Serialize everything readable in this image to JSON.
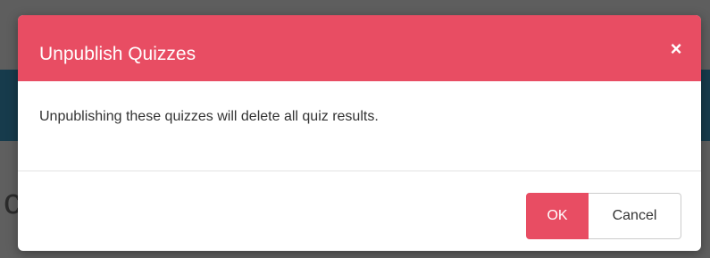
{
  "background": {
    "partial_glyph": "c"
  },
  "dialog": {
    "title": "Unpublish Quizzes",
    "close_glyph": "×",
    "message": "Unpublishing these quizzes will delete all quiz results.",
    "ok_label": "OK",
    "cancel_label": "Cancel"
  },
  "colors": {
    "accent": "#e84d63",
    "header_text": "#ffffff",
    "body_text": "#333333",
    "overlay": "#5e5e5e",
    "background_band": "#173b4c"
  },
  "icons": {
    "close": "close-icon"
  }
}
